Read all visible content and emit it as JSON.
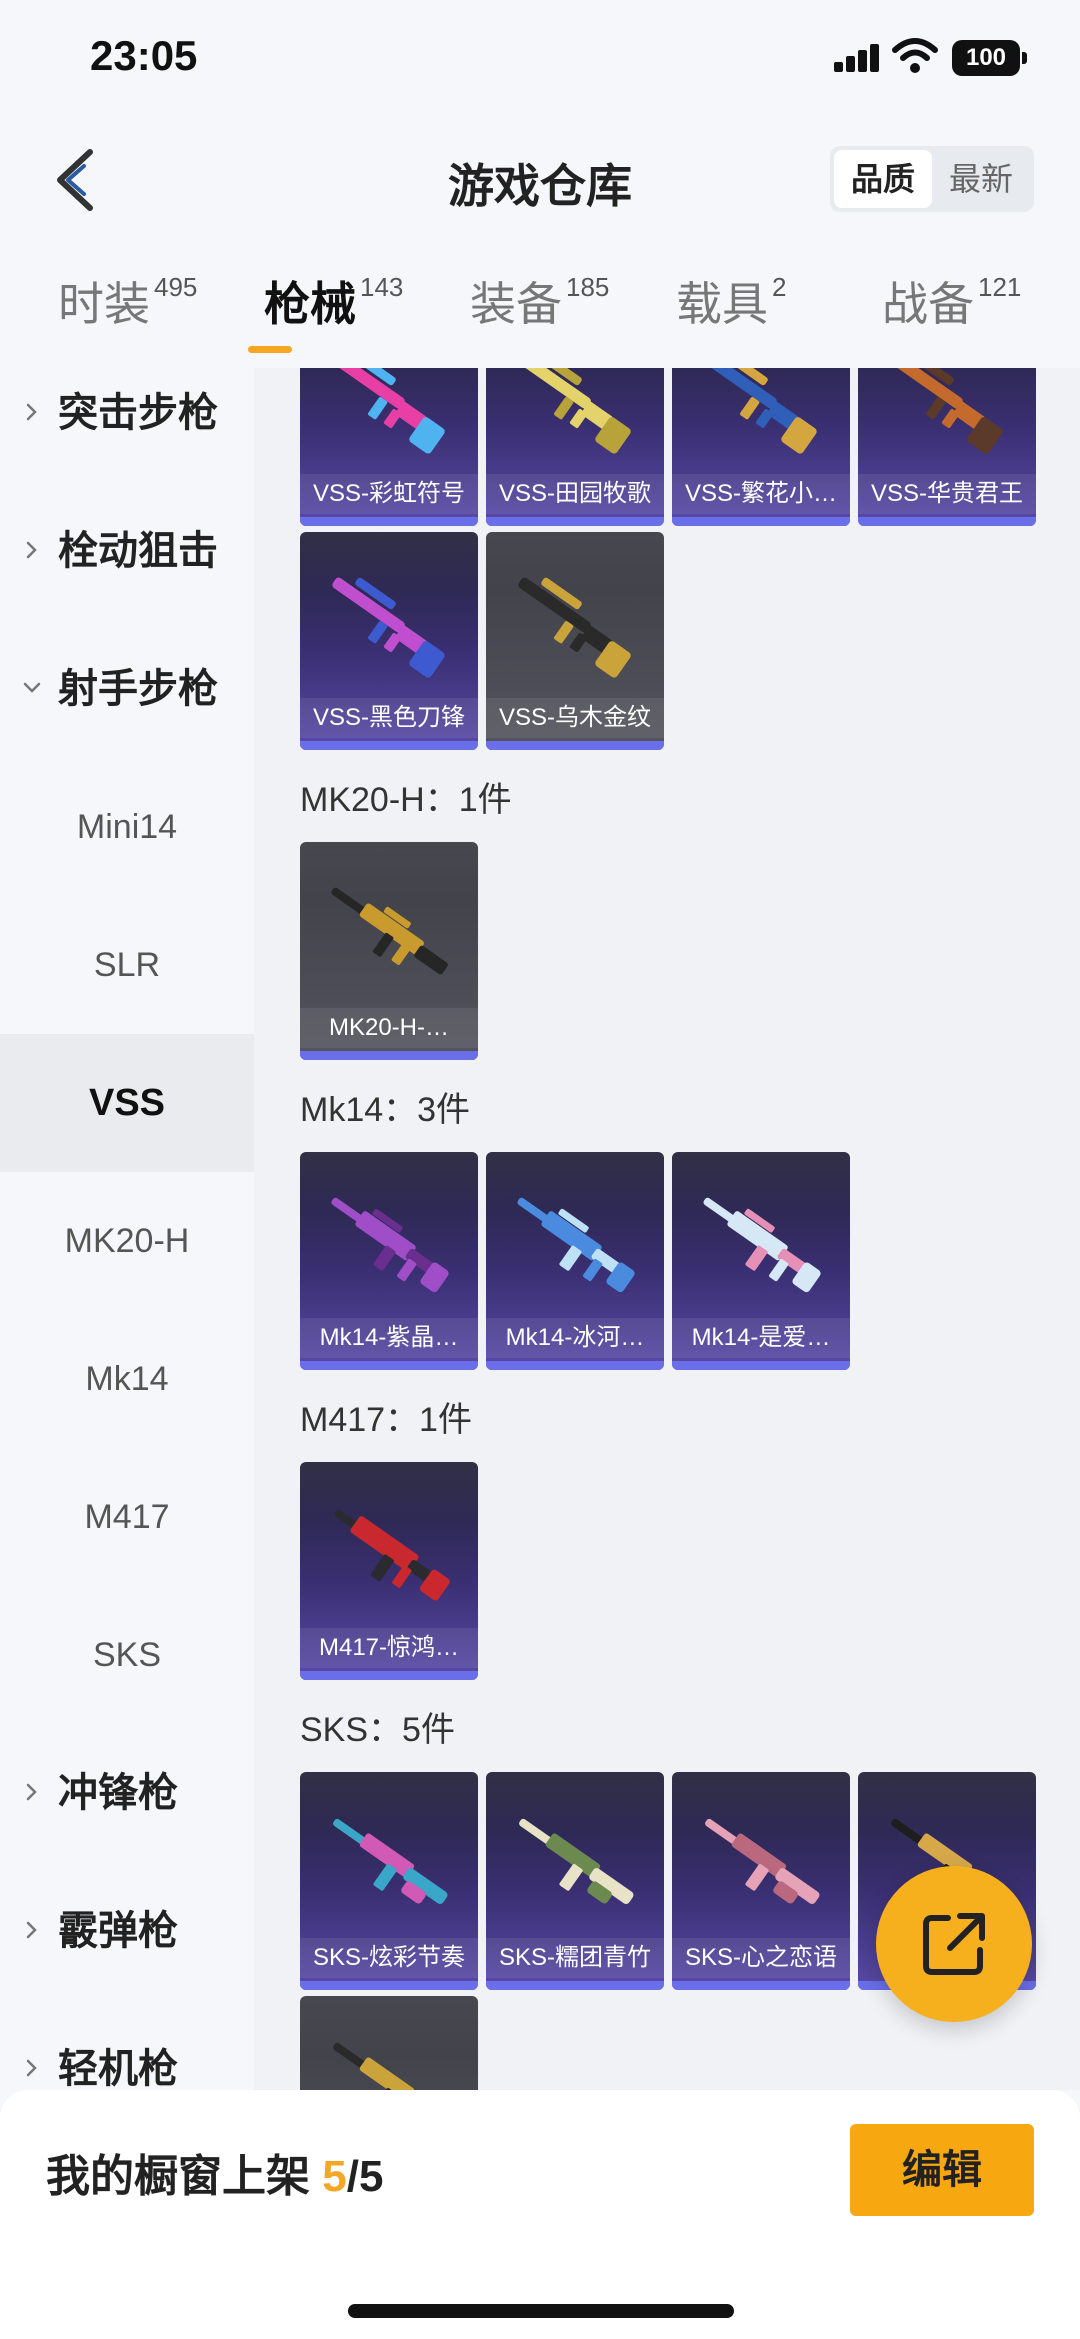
{
  "status": {
    "time": "23:05",
    "battery": "100"
  },
  "header": {
    "title": "游戏仓库",
    "sort_options": [
      "品质",
      "最新"
    ],
    "active_sort": "品质"
  },
  "tabs": [
    {
      "label": "时装",
      "count": "495"
    },
    {
      "label": "枪械",
      "count": "143",
      "active": true
    },
    {
      "label": "装备",
      "count": "185"
    },
    {
      "label": "载具",
      "count": "2"
    },
    {
      "label": "战备",
      "count": "121"
    }
  ],
  "sidebar": {
    "items": [
      {
        "label": "突击步枪",
        "kind": "category",
        "state": "collapsed"
      },
      {
        "label": "栓动狙击",
        "kind": "category",
        "state": "collapsed"
      },
      {
        "label": "射手步枪",
        "kind": "category",
        "state": "expanded"
      },
      {
        "label": "Mini14",
        "kind": "sub"
      },
      {
        "label": "SLR",
        "kind": "sub"
      },
      {
        "label": "VSS",
        "kind": "sub",
        "active": true
      },
      {
        "label": "MK20-H",
        "kind": "sub"
      },
      {
        "label": "Mk14",
        "kind": "sub"
      },
      {
        "label": "M417",
        "kind": "sub"
      },
      {
        "label": "SKS",
        "kind": "sub"
      },
      {
        "label": "冲锋枪",
        "kind": "category",
        "state": "collapsed"
      },
      {
        "label": "霰弹枪",
        "kind": "category",
        "state": "collapsed"
      },
      {
        "label": "轻机枪",
        "kind": "category",
        "state": "collapsed"
      }
    ]
  },
  "groups": [
    {
      "title": "",
      "items": [
        {
          "name": "VSS-彩虹符号",
          "style": "purple",
          "gun": "vss",
          "colors": [
            "#e83fa6",
            "#4fb3f0"
          ]
        },
        {
          "name": "VSS-田园牧歌",
          "style": "purple",
          "gun": "vss",
          "colors": [
            "#e4d36a",
            "#b8a23a"
          ]
        },
        {
          "name": "VSS-繁花小…",
          "style": "purple",
          "gun": "vss",
          "colors": [
            "#2f5fb8",
            "#d4a640"
          ]
        },
        {
          "name": "VSS-华贵君王",
          "style": "purple",
          "gun": "vss",
          "colors": [
            "#c46a2c",
            "#5b3a2a"
          ]
        },
        {
          "name": "VSS-黑色刀锋",
          "style": "purple",
          "gun": "vss",
          "colors": [
            "#c04fcf",
            "#3d5ad0"
          ]
        },
        {
          "name": "VSS-乌木金纹",
          "style": "gray",
          "gun": "vss",
          "colors": [
            "#2a2a2a",
            "#caa33a"
          ]
        }
      ]
    },
    {
      "title": "MK20-H：1件",
      "items": [
        {
          "name": "MK20-H-…",
          "style": "gray",
          "gun": "rifle",
          "colors": [
            "#262626",
            "#c99a2e"
          ]
        }
      ]
    },
    {
      "title": "Mk14：3件",
      "items": [
        {
          "name": "Mk14-紫晶…",
          "style": "purple",
          "gun": "mk14",
          "colors": [
            "#a04ec8",
            "#6a2e8e"
          ]
        },
        {
          "name": "Mk14-冰河…",
          "style": "purple",
          "gun": "mk14",
          "colors": [
            "#4a8be0",
            "#bfe1f5"
          ]
        },
        {
          "name": "Mk14-是爱…",
          "style": "purple",
          "gun": "mk14",
          "colors": [
            "#d6e8f5",
            "#e68fb7"
          ]
        }
      ]
    },
    {
      "title": "M417：1件",
      "items": [
        {
          "name": "M417-惊鸿…",
          "style": "purple",
          "gun": "m417",
          "colors": [
            "#c8282e",
            "#2a2a30"
          ]
        }
      ]
    },
    {
      "title": "SKS：5件",
      "items": [
        {
          "name": "SKS-炫彩节奏",
          "style": "purple",
          "gun": "sks",
          "colors": [
            "#3aa6c8",
            "#d05ab6"
          ]
        },
        {
          "name": "SKS-糯团青竹",
          "style": "purple",
          "gun": "sks",
          "colors": [
            "#e8e2c6",
            "#6c8a50"
          ]
        },
        {
          "name": "SKS-心之恋语",
          "style": "purple",
          "gun": "sks",
          "colors": [
            "#e6a2b6",
            "#b9687e"
          ]
        },
        {
          "name": "",
          "style": "purple",
          "gun": "sks",
          "colors": [
            "#1e1e1e",
            "#d6a84a"
          ]
        },
        {
          "name": "",
          "style": "gray",
          "gun": "sks",
          "colors": [
            "#2a2a2a",
            "#caa33a"
          ]
        }
      ]
    }
  ],
  "bottom": {
    "showcase_label": "我的橱窗上架",
    "showcase_count": "5",
    "showcase_sep": "/",
    "showcase_total": "5",
    "edit_label": "编辑"
  }
}
